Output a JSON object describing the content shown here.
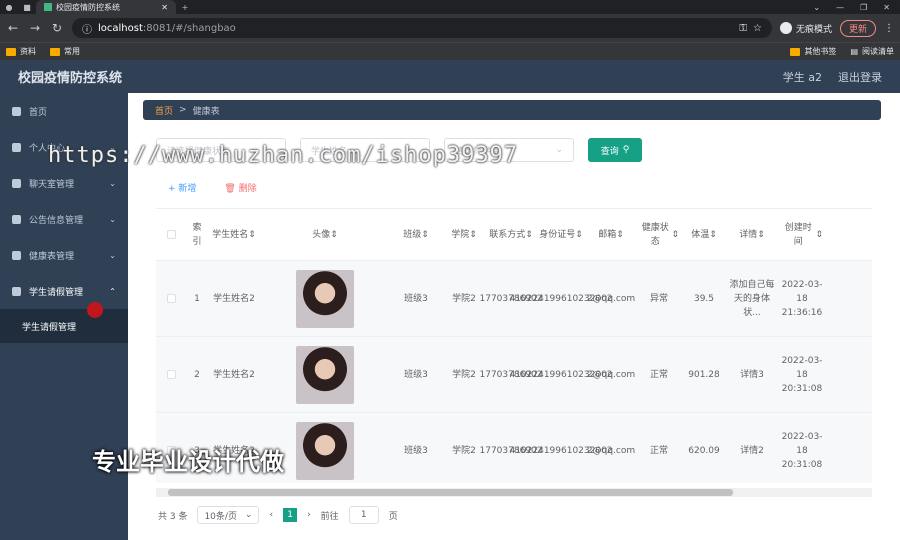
{
  "browser": {
    "tab_title": "校园疫情防控系统",
    "url_host": "localhost",
    "url_path": ":8081/#/shangbao",
    "incognito_label": "无痕模式",
    "update_label": "更新",
    "bookmarks": [
      "资料",
      "常用"
    ],
    "bookmarks_right": [
      "其他书签",
      "阅读清单"
    ]
  },
  "header": {
    "title": "校园疫情防控系统",
    "user": "学生 a2",
    "logout": "退出登录"
  },
  "sidebar": {
    "items": [
      {
        "label": "首页",
        "icon": "home-icon"
      },
      {
        "label": "个人中心",
        "icon": "user-icon"
      },
      {
        "label": "聊天室管理",
        "icon": "chat-icon"
      },
      {
        "label": "公告信息管理",
        "icon": "notice-icon"
      },
      {
        "label": "健康表管理",
        "icon": "health-icon"
      },
      {
        "label": "学生请假管理",
        "icon": "power-icon"
      }
    ],
    "submenu": "学生请假管理"
  },
  "breadcrumb": {
    "home": "首页",
    "current": "健康表"
  },
  "search": {
    "input1_placeholder": "请选择健康状态",
    "input2_placeholder": "学生姓名",
    "select_placeholder": "请选择学院",
    "button": "查询"
  },
  "actions": {
    "add": "新增",
    "delete": "删除"
  },
  "table": {
    "headers": [
      "索引",
      "学生姓名",
      "头像",
      "班级",
      "学院",
      "联系方式",
      "身份证号",
      "邮箱",
      "健康状态",
      "体温",
      "详情",
      "创建时间"
    ],
    "rows": [
      {
        "index": "1",
        "name": "学生姓名2",
        "class": "班级3",
        "college": "学院2",
        "phone": "17703786902",
        "id": "410224199610232002",
        "email": "2@qq.com",
        "status": "异常",
        "temp": "39.5",
        "detail": "添加自己每天的身体状...",
        "created": "2022-03-18 21:36:16"
      },
      {
        "index": "2",
        "name": "学生姓名2",
        "class": "班级3",
        "college": "学院2",
        "phone": "17703786902",
        "id": "410224199610232002",
        "email": "2@qq.com",
        "status": "正常",
        "temp": "901.28",
        "detail": "详情3",
        "created": "2022-03-18 20:31:08"
      },
      {
        "index": "3",
        "name": "学生姓名2",
        "class": "班级3",
        "college": "学院2",
        "phone": "17703786902",
        "id": "410224199610232002",
        "email": "2@qq.com",
        "status": "正常",
        "temp": "620.09",
        "detail": "详情2",
        "created": "2022-03-18 20:31:08"
      }
    ]
  },
  "pagination": {
    "total": "共 3 条",
    "page_size": "10条/页",
    "current_page": "1",
    "goto_prefix": "前往",
    "goto_value": "1",
    "goto_suffix": "页"
  },
  "overlays": {
    "watermark_url": "https://www.huzhan.com/ishop39397",
    "watermark_text": "专业毕业设计代做"
  }
}
